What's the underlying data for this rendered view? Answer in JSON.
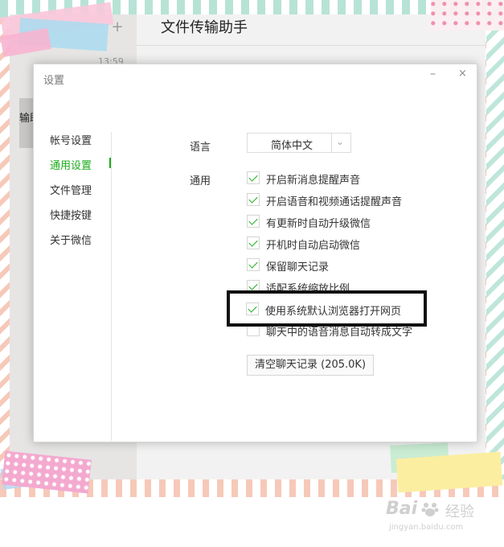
{
  "app": {
    "chat_title": "文件传输助手",
    "chat_time": "13:59",
    "chat_name_partial": "输助",
    "add_symbol": "+"
  },
  "dialog": {
    "title": "设置",
    "min_glyph": "–",
    "close_glyph": "×"
  },
  "nav": {
    "items": [
      {
        "label": "帐号设置",
        "active": false
      },
      {
        "label": "通用设置",
        "active": true
      },
      {
        "label": "文件管理",
        "active": false
      },
      {
        "label": "快捷按键",
        "active": false
      },
      {
        "label": "关于微信",
        "active": false
      }
    ]
  },
  "general": {
    "language_label": "语言",
    "language_value": "简体中文",
    "general_label": "通用",
    "options": [
      {
        "label": "开启新消息提醒声音",
        "checked": true
      },
      {
        "label": "开启语音和视频通话提醒声音",
        "checked": true
      },
      {
        "label": "有更新时自动升级微信",
        "checked": true
      },
      {
        "label": "开机时自动启动微信",
        "checked": true
      },
      {
        "label": "保留聊天记录",
        "checked": true
      },
      {
        "label": "适配系统缩放比例",
        "checked": true
      },
      {
        "label": "使用系统默认浏览器打开网页",
        "checked": true
      },
      {
        "label": "聊天中的语音消息自动转成文字",
        "checked": false
      }
    ],
    "clear_button": "清空聊天记录 (205.0K)"
  },
  "watermark": {
    "brand": "Bai",
    "brand_cn": "经验",
    "url": "jingyan.baidu.com"
  },
  "colors": {
    "accent_green": "#1aad19",
    "highlight_border": "#111111"
  }
}
